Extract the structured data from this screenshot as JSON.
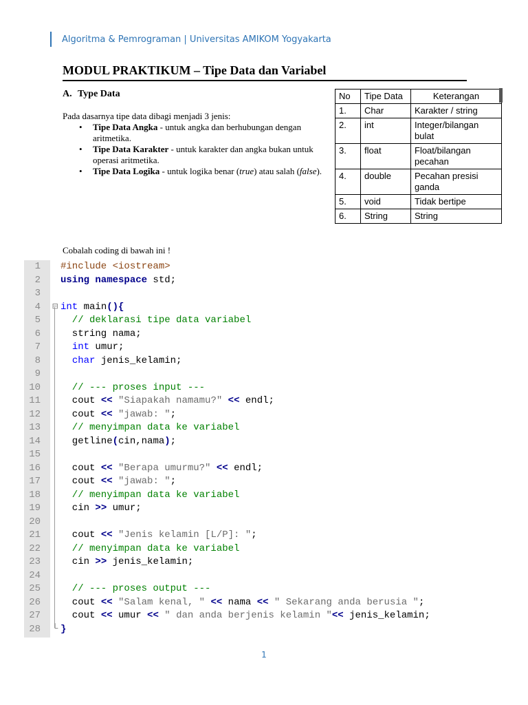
{
  "header": {
    "text": "Algoritma & Pemrograman | Universitas AMIKOM Yogyakarta"
  },
  "title": "MODUL PRAKTIKUM – Tipe Data dan Variabel",
  "section": {
    "number": "A.",
    "title": "Type Data"
  },
  "intro": "Pada dasarnya tipe data dibagi menjadi 3 jenis:",
  "bullets": [
    {
      "bold": "Tipe Data Angka",
      "text1": " - untuk angka dan berhubungan dengan aritmetika.",
      "em1": "",
      "text2": "",
      "em2": "",
      "text3": ""
    },
    {
      "bold": "Tipe Data Karakter",
      "text1": " - untuk karakter dan angka bukan untuk operasi aritmetika.",
      "em1": "",
      "text2": "",
      "em2": "",
      "text3": ""
    },
    {
      "bold": "Tipe Data Logika",
      "text1": " - untuk logika benar (",
      "em1": "true",
      "text2": ") atau salah (",
      "em2": "false",
      "text3": ")."
    }
  ],
  "table": {
    "headers": [
      "No",
      "Tipe Data",
      "Keterangan"
    ],
    "rows": [
      [
        "1.",
        "Char",
        "Karakter / string"
      ],
      [
        "2.",
        "int",
        "Integer/bilangan bulat"
      ],
      [
        "3.",
        "float",
        "Float/bilangan pecahan"
      ],
      [
        "4.",
        "double",
        "Pecahan presisi ganda"
      ],
      [
        "5.",
        "void",
        "Tidak bertipe"
      ],
      [
        "6.",
        "String",
        "String"
      ]
    ]
  },
  "try_text": "Cobalah coding di bawah ini !",
  "code": {
    "line_numbers": [
      "1",
      "2",
      "3",
      "4",
      "5",
      "6",
      "7",
      "8",
      "9",
      "10",
      "11",
      "12",
      "13",
      "14",
      "15",
      "16",
      "17",
      "18",
      "19",
      "20",
      "21",
      "22",
      "23",
      "24",
      "25",
      "26",
      "27",
      "28"
    ],
    "fold_markers": [
      "",
      "",
      "",
      "⊟",
      "",
      "",
      "",
      "",
      "",
      "",
      "",
      "",
      "",
      "",
      "",
      "",
      "",
      "",
      "",
      "",
      "",
      "",
      "",
      "",
      "",
      "",
      "",
      "└"
    ],
    "lines": [
      [
        {
          "t": "#include <iostream>",
          "c": "pp"
        }
      ],
      [
        {
          "t": "using namespace",
          "c": "kwb"
        },
        {
          "t": " std;",
          "c": ""
        }
      ],
      [],
      [
        {
          "t": "int",
          "c": "kw"
        },
        {
          "t": " main",
          "c": ""
        },
        {
          "t": "(){",
          "c": "brk"
        }
      ],
      [
        {
          "t": "  // deklarasi tipe data variabel",
          "c": "cm"
        }
      ],
      [
        {
          "t": "  string nama;",
          "c": ""
        }
      ],
      [
        {
          "t": "  ",
          "c": ""
        },
        {
          "t": "int",
          "c": "kw"
        },
        {
          "t": " umur;",
          "c": ""
        }
      ],
      [
        {
          "t": "  ",
          "c": ""
        },
        {
          "t": "char",
          "c": "kw"
        },
        {
          "t": " jenis_kelamin;",
          "c": ""
        }
      ],
      [],
      [
        {
          "t": "  // --- proses input ---",
          "c": "cm"
        }
      ],
      [
        {
          "t": "  cout ",
          "c": ""
        },
        {
          "t": "<<",
          "c": "op"
        },
        {
          "t": " ",
          "c": ""
        },
        {
          "t": "\"Siapakah namamu?\"",
          "c": "st"
        },
        {
          "t": " ",
          "c": ""
        },
        {
          "t": "<<",
          "c": "op"
        },
        {
          "t": " endl;",
          "c": ""
        }
      ],
      [
        {
          "t": "  cout ",
          "c": ""
        },
        {
          "t": "<<",
          "c": "op"
        },
        {
          "t": " ",
          "c": ""
        },
        {
          "t": "\"jawab: \"",
          "c": "st"
        },
        {
          "t": ";",
          "c": ""
        }
      ],
      [
        {
          "t": "  // menyimpan data ke variabel",
          "c": "cm"
        }
      ],
      [
        {
          "t": "  getline",
          "c": ""
        },
        {
          "t": "(",
          "c": "brk"
        },
        {
          "t": "cin,nama",
          "c": ""
        },
        {
          "t": ")",
          "c": "brk"
        },
        {
          "t": ";",
          "c": ""
        }
      ],
      [],
      [
        {
          "t": "  cout ",
          "c": ""
        },
        {
          "t": "<<",
          "c": "op"
        },
        {
          "t": " ",
          "c": ""
        },
        {
          "t": "\"Berapa umurmu?\"",
          "c": "st"
        },
        {
          "t": " ",
          "c": ""
        },
        {
          "t": "<<",
          "c": "op"
        },
        {
          "t": " endl;",
          "c": ""
        }
      ],
      [
        {
          "t": "  cout ",
          "c": ""
        },
        {
          "t": "<<",
          "c": "op"
        },
        {
          "t": " ",
          "c": ""
        },
        {
          "t": "\"jawab: \"",
          "c": "st"
        },
        {
          "t": ";",
          "c": ""
        }
      ],
      [
        {
          "t": "  // menyimpan data ke variabel",
          "c": "cm"
        }
      ],
      [
        {
          "t": "  cin ",
          "c": ""
        },
        {
          "t": ">>",
          "c": "op"
        },
        {
          "t": " umur;",
          "c": ""
        }
      ],
      [],
      [
        {
          "t": "  cout ",
          "c": ""
        },
        {
          "t": "<<",
          "c": "op"
        },
        {
          "t": " ",
          "c": ""
        },
        {
          "t": "\"Jenis kelamin [L/P]: \"",
          "c": "st"
        },
        {
          "t": ";",
          "c": ""
        }
      ],
      [
        {
          "t": "  // menyimpan data ke variabel",
          "c": "cm"
        }
      ],
      [
        {
          "t": "  cin ",
          "c": ""
        },
        {
          "t": ">>",
          "c": "op"
        },
        {
          "t": " jenis_kelamin;",
          "c": ""
        }
      ],
      [],
      [
        {
          "t": "  // --- proses output ---",
          "c": "cm"
        }
      ],
      [
        {
          "t": "  cout ",
          "c": ""
        },
        {
          "t": "<<",
          "c": "op"
        },
        {
          "t": " ",
          "c": ""
        },
        {
          "t": "\"Salam kenal, \"",
          "c": "st"
        },
        {
          "t": " ",
          "c": ""
        },
        {
          "t": "<<",
          "c": "op"
        },
        {
          "t": " nama ",
          "c": ""
        },
        {
          "t": "<<",
          "c": "op"
        },
        {
          "t": " ",
          "c": ""
        },
        {
          "t": "\" Sekarang anda berusia \"",
          "c": "st"
        },
        {
          "t": ";",
          "c": ""
        }
      ],
      [
        {
          "t": "  cout ",
          "c": ""
        },
        {
          "t": "<<",
          "c": "op"
        },
        {
          "t": " umur ",
          "c": ""
        },
        {
          "t": "<<",
          "c": "op"
        },
        {
          "t": " ",
          "c": ""
        },
        {
          "t": "\" dan anda berjenis kelamin \"",
          "c": "st"
        },
        {
          "t": "<<",
          "c": "op"
        },
        {
          "t": " jenis_kelamin;",
          "c": ""
        }
      ],
      [
        {
          "t": "}",
          "c": "brk"
        }
      ]
    ]
  },
  "page_number": "1"
}
